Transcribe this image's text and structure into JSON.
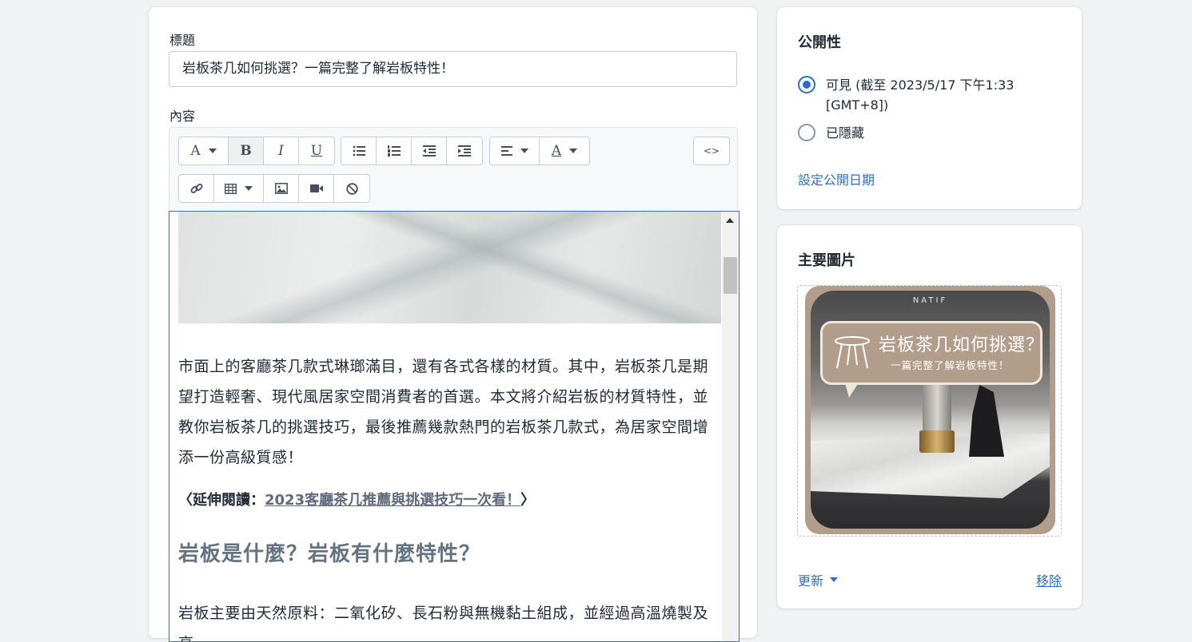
{
  "form": {
    "title_label": "標題",
    "title_value": "岩板茶几如何挑選？一篇完整了解岩板特性！",
    "content_label": "內容"
  },
  "toolbar": {
    "font_icon": "A",
    "bold_icon": "B",
    "italic_icon": "I",
    "underline_icon": "U",
    "text_color_icon": "A",
    "source_icon": "<>"
  },
  "editor": {
    "paragraph1": "市面上的客廳茶几款式琳瑯滿目，還有各式各樣的材質。其中，岩板茶几是期望打造輕奢、現代風居家空間消費者的首選。本文將介紹岩板的材質特性，並教你岩板茶几的挑選技巧，最後推薦幾款熱門的岩板茶几款式，為居家空間增添一份高級質感！",
    "extend_prefix": "〈延伸閱讀：",
    "extend_link": "2023客廳茶几推薦與挑選技巧一次看！",
    "extend_suffix": "〉",
    "heading": "岩板是什麼？岩板有什麼特性？",
    "paragraph2": "岩板主要由天然原料：二氧化矽、長石粉與無機黏土組成，並經過高溫燒製及高"
  },
  "visibility": {
    "title": "公開性",
    "visible_label": "可見 (截至 2023/5/17 下午1:33 [GMT+8])",
    "hidden_label": "已隱藏",
    "set_date_link": "設定公開日期",
    "selected": "visible"
  },
  "featured_image": {
    "title": "主要圖片",
    "brand": "NATIF",
    "bubble_title": "岩板茶几如何挑選？",
    "bubble_subtitle": "一篇完整了解岩板特性！",
    "update_label": "更新",
    "remove_label": "移除"
  },
  "colors": {
    "accent": "#2c6ecb",
    "editor_focus_border": "#3f6fbd",
    "bubble": "#b29d8a"
  }
}
